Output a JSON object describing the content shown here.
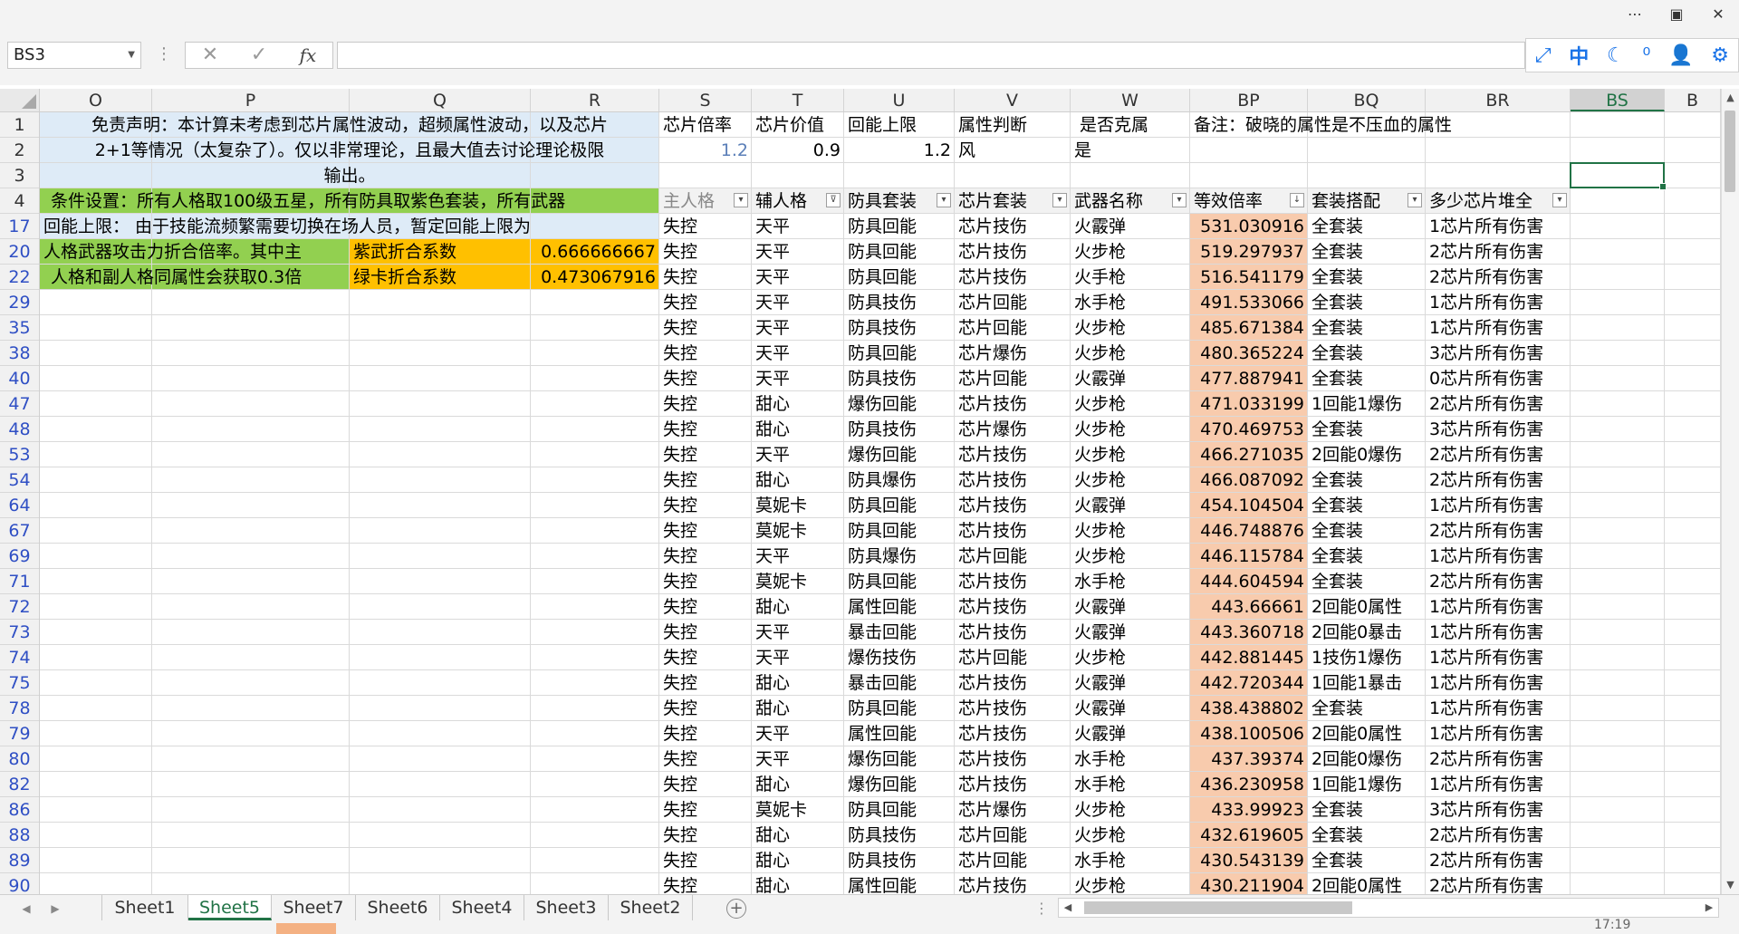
{
  "window": {
    "min_icon": "ellipsis-icon",
    "restore_icon": "restore-icon",
    "close_icon": "close-icon"
  },
  "formula_bar": {
    "name_box": "BS3",
    "cancel_icon": "✕",
    "enter_icon": "✓",
    "fx_label": "fx",
    "formula": ""
  },
  "ime_toolbar": [
    "⤢",
    "中",
    "☾",
    "⁰",
    "👤",
    "⚙"
  ],
  "columns": [
    "O",
    "P",
    "Q",
    "R",
    "S",
    "T",
    "U",
    "V",
    "W",
    "BP",
    "BQ",
    "BR",
    "BS",
    "B"
  ],
  "selected_column": "BS",
  "row_numbers": [
    "1",
    "2",
    "3",
    "4",
    "17",
    "20",
    "22",
    "29",
    "35",
    "38",
    "40",
    "47",
    "48",
    "53",
    "54",
    "64",
    "67",
    "69",
    "71",
    "72",
    "73",
    "74",
    "75",
    "78",
    "79",
    "80",
    "82",
    "86",
    "88",
    "89",
    "90"
  ],
  "notes": {
    "disclaimer_line1": "免责声明：本计算未考虑到芯片属性波动，超频属性波动，以及芯片",
    "disclaimer_line2": "2+1等情况（太复杂了）。仅以非常理论，且最大值去讨论理论极限",
    "disclaimer_line3": "输出。",
    "conditions": "条件设置：所有人格取100级五星，所有防具取紫色套装，所有武器",
    "recharge_limit": "回能上限：      由于技能流频繁需要切换在场人员，暂定回能上限为",
    "weapon_factor_line1": "人格武器攻击力折合倍率。其中主",
    "weapon_factor_line2": "人格和副人格同属性会获取0.3倍",
    "purple_label": "紫武折合系数",
    "purple_value": "0.666666667",
    "green_label": "绿卡折合系数",
    "green_value": "0.473067916"
  },
  "params": {
    "headers": [
      "芯片倍率",
      "芯片价值",
      "回能上限",
      "属性判断",
      "是否克属"
    ],
    "values": [
      "1.2",
      "0.9",
      "1.2",
      "风",
      "是"
    ],
    "remark": "备注：破晓的属性是不压血的属性"
  },
  "table": {
    "headers": [
      "主人格",
      "辅人格",
      "防具套装",
      "芯片套装",
      "武器名称",
      "等效倍率",
      "套装搭配",
      "多少芯片堆全"
    ],
    "filter_icons": [
      "▾",
      "⊽",
      "▾",
      "▾",
      "▾",
      "▾",
      "↓",
      "▾",
      "▾"
    ],
    "rows": [
      [
        "失控",
        "天平",
        "防具回能",
        "芯片技伤",
        "火霰弹",
        "531.030916",
        "全套装",
        "1芯片所有伤害"
      ],
      [
        "失控",
        "天平",
        "防具回能",
        "芯片技伤",
        "火步枪",
        "519.297937",
        "全套装",
        "2芯片所有伤害"
      ],
      [
        "失控",
        "天平",
        "防具回能",
        "芯片技伤",
        "火手枪",
        "516.541179",
        "全套装",
        "2芯片所有伤害"
      ],
      [
        "失控",
        "天平",
        "防具技伤",
        "芯片回能",
        "水手枪",
        "491.533066",
        "全套装",
        "1芯片所有伤害"
      ],
      [
        "失控",
        "天平",
        "防具技伤",
        "芯片回能",
        "火步枪",
        "485.671384",
        "全套装",
        "1芯片所有伤害"
      ],
      [
        "失控",
        "天平",
        "防具回能",
        "芯片爆伤",
        "火步枪",
        "480.365224",
        "全套装",
        "3芯片所有伤害"
      ],
      [
        "失控",
        "天平",
        "防具技伤",
        "芯片回能",
        "火霰弹",
        "477.887941",
        "全套装",
        "0芯片所有伤害"
      ],
      [
        "失控",
        "甜心",
        "爆伤回能",
        "芯片技伤",
        "火步枪",
        "471.033199",
        "1回能1爆伤",
        "2芯片所有伤害"
      ],
      [
        "失控",
        "甜心",
        "防具技伤",
        "芯片爆伤",
        "火步枪",
        "470.469753",
        "全套装",
        "3芯片所有伤害"
      ],
      [
        "失控",
        "天平",
        "爆伤回能",
        "芯片技伤",
        "火步枪",
        "466.271035",
        "2回能0爆伤",
        "2芯片所有伤害"
      ],
      [
        "失控",
        "甜心",
        "防具爆伤",
        "芯片技伤",
        "火步枪",
        "466.087092",
        "全套装",
        "2芯片所有伤害"
      ],
      [
        "失控",
        "莫妮卡",
        "防具回能",
        "芯片技伤",
        "火霰弹",
        "454.104504",
        "全套装",
        "1芯片所有伤害"
      ],
      [
        "失控",
        "莫妮卡",
        "防具回能",
        "芯片技伤",
        "火步枪",
        "446.748876",
        "全套装",
        "2芯片所有伤害"
      ],
      [
        "失控",
        "天平",
        "防具爆伤",
        "芯片回能",
        "火步枪",
        "446.115784",
        "全套装",
        "1芯片所有伤害"
      ],
      [
        "失控",
        "莫妮卡",
        "防具回能",
        "芯片技伤",
        "水手枪",
        "444.604594",
        "全套装",
        "2芯片所有伤害"
      ],
      [
        "失控",
        "甜心",
        "属性回能",
        "芯片技伤",
        "火霰弹",
        "443.66661",
        "2回能0属性",
        "1芯片所有伤害"
      ],
      [
        "失控",
        "天平",
        "暴击回能",
        "芯片技伤",
        "火霰弹",
        "443.360718",
        "2回能0暴击",
        "1芯片所有伤害"
      ],
      [
        "失控",
        "天平",
        "爆伤技伤",
        "芯片回能",
        "火步枪",
        "442.881445",
        "1技伤1爆伤",
        "1芯片所有伤害"
      ],
      [
        "失控",
        "甜心",
        "暴击回能",
        "芯片技伤",
        "火霰弹",
        "442.720344",
        "1回能1暴击",
        "1芯片所有伤害"
      ],
      [
        "失控",
        "甜心",
        "防具回能",
        "芯片技伤",
        "火霰弹",
        "438.438802",
        "全套装",
        "1芯片所有伤害"
      ],
      [
        "失控",
        "天平",
        "属性回能",
        "芯片技伤",
        "火霰弹",
        "438.100506",
        "2回能0属性",
        "1芯片所有伤害"
      ],
      [
        "失控",
        "天平",
        "爆伤回能",
        "芯片技伤",
        "水手枪",
        "437.39374",
        "2回能0爆伤",
        "2芯片所有伤害"
      ],
      [
        "失控",
        "甜心",
        "爆伤回能",
        "芯片技伤",
        "水手枪",
        "436.230958",
        "1回能1爆伤",
        "1芯片所有伤害"
      ],
      [
        "失控",
        "莫妮卡",
        "防具回能",
        "芯片爆伤",
        "火步枪",
        "433.99923",
        "全套装",
        "3芯片所有伤害"
      ],
      [
        "失控",
        "甜心",
        "防具技伤",
        "芯片回能",
        "火步枪",
        "432.619605",
        "全套装",
        "2芯片所有伤害"
      ],
      [
        "失控",
        "甜心",
        "防具技伤",
        "芯片回能",
        "水手枪",
        "430.543139",
        "全套装",
        "2芯片所有伤害"
      ],
      [
        "失控",
        "甜心",
        "属性回能",
        "芯片技伤",
        "火步枪",
        "430.211904",
        "2回能0属性",
        "2芯片所有伤害"
      ]
    ]
  },
  "sheets": [
    "Sheet1",
    "Sheet5",
    "Sheet7",
    "Sheet6",
    "Sheet4",
    "Sheet3",
    "Sheet2"
  ],
  "active_sheet": "Sheet5",
  "status_text": "17:19",
  "colors": {
    "accent": "#217346",
    "note_blue": "#deebf7",
    "green_fill": "#92d050",
    "orange_fill": "#ffc000",
    "salmon_fill": "#f8cbad",
    "ime_blue": "#1a73e8"
  }
}
